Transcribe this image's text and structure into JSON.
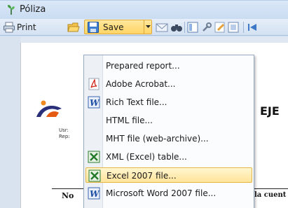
{
  "window": {
    "title": "Póliza"
  },
  "toolbar": {
    "print_label": "Print",
    "save_label": "Save"
  },
  "menu": {
    "items": [
      {
        "label": "Prepared report...",
        "icon": "none"
      },
      {
        "label": "Adobe Acrobat...",
        "icon": "pdf-icon"
      },
      {
        "label": "Rich Text file...",
        "icon": "word-icon"
      },
      {
        "label": "HTML file...",
        "icon": "none"
      },
      {
        "label": "MHT file (web-archive)...",
        "icon": "none"
      },
      {
        "label": "XML (Excel) table...",
        "icon": "excel-icon"
      },
      {
        "label": "Excel 2007 file...",
        "icon": "excel-icon",
        "highlighted": true
      },
      {
        "label": "Microsoft Word 2007 file...",
        "icon": "word-icon"
      }
    ]
  },
  "document": {
    "heading": "EJE",
    "user_label": "Usr:",
    "rep_label": "Rep:",
    "col_no": "No",
    "col_cuenta": "la cuent"
  },
  "colors": {
    "highlight": "#ffe49b",
    "highlight_border": "#e4b64a",
    "save_button": "#ffd565",
    "toolbar": "#d3e1f2"
  }
}
